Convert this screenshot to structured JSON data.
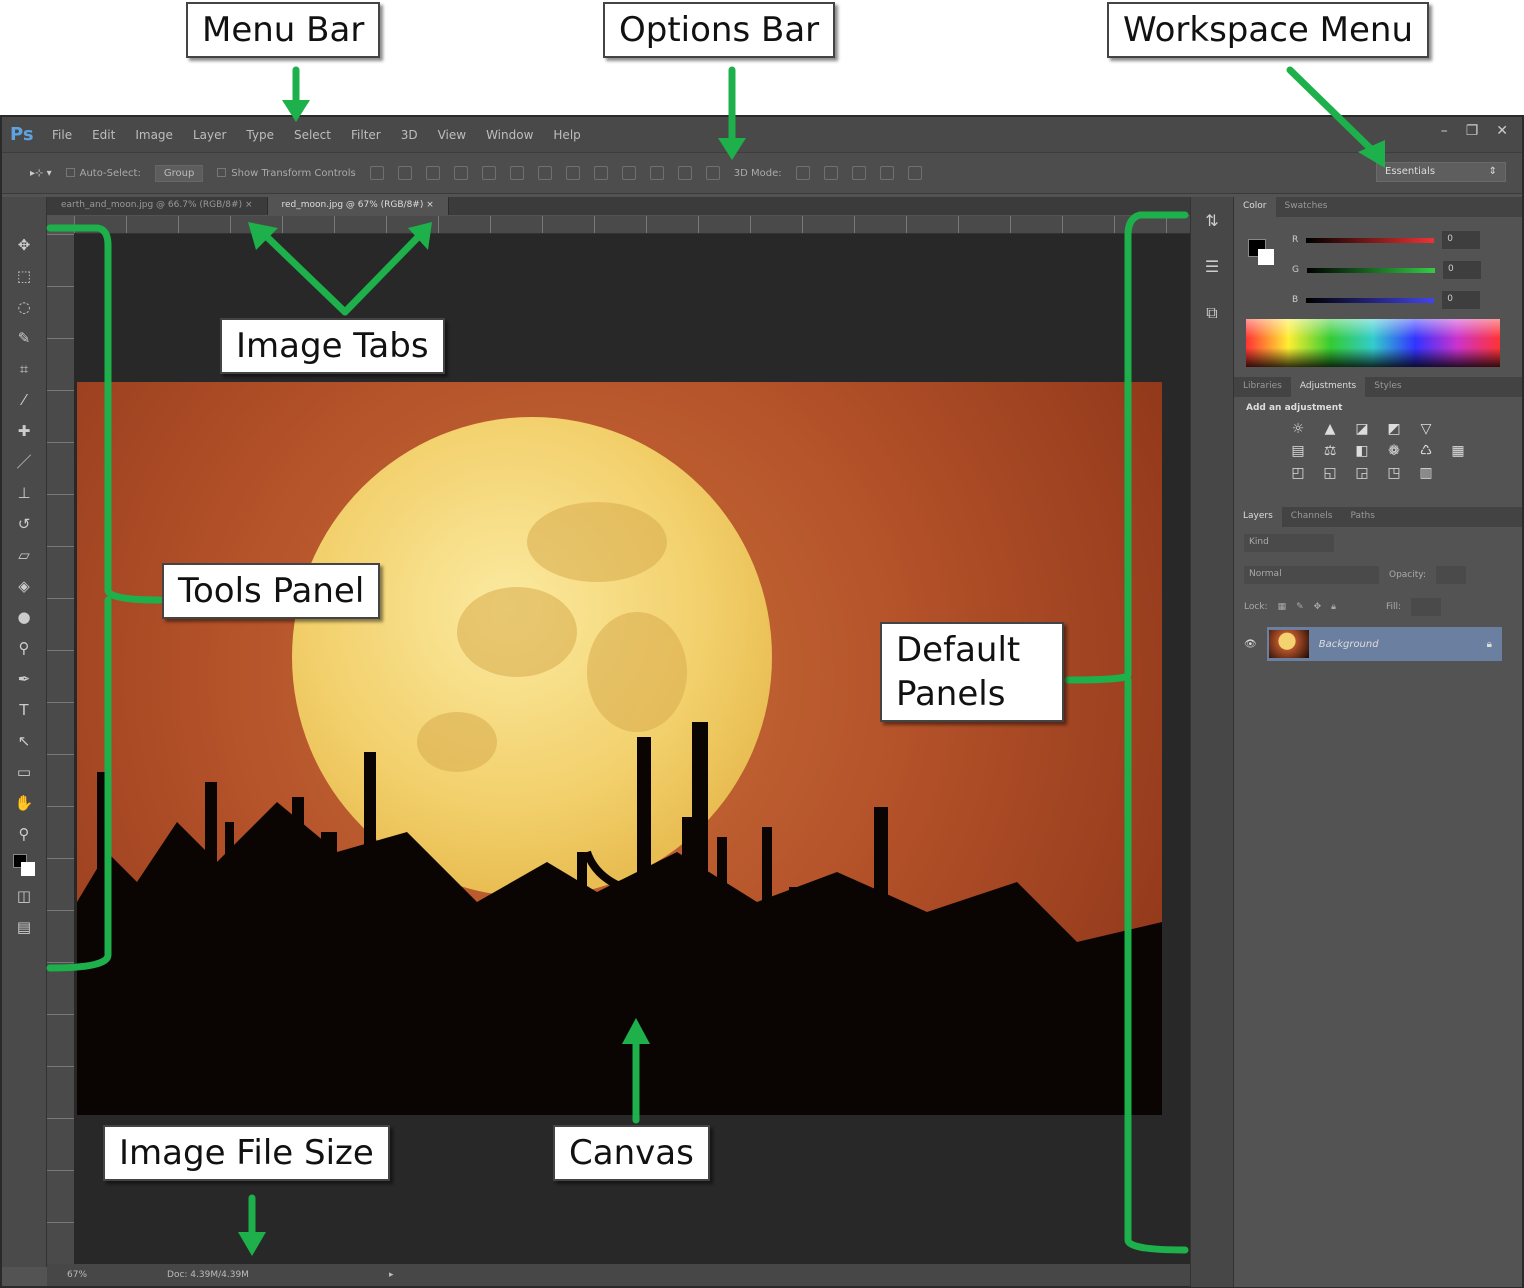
{
  "annotations": {
    "menu_bar": "Menu Bar",
    "options_bar": "Options Bar",
    "workspace_menu": "Workspace Menu",
    "image_tabs": "Image Tabs",
    "tools_panel": "Tools Panel",
    "default_panels": "Default Panels",
    "image_file_size": "Image File Size",
    "canvas": "Canvas"
  },
  "app": {
    "logo": "Ps"
  },
  "menu": [
    "File",
    "Edit",
    "Image",
    "Layer",
    "Type",
    "Select",
    "Filter",
    "3D",
    "View",
    "Window",
    "Help"
  ],
  "window_controls": {
    "minimize": "–",
    "restore": "❐",
    "close": "✕"
  },
  "options": {
    "auto_select": "Auto-Select:",
    "group": "Group",
    "show_transform": "Show Transform Controls",
    "mode_3d": "3D Mode:"
  },
  "workspace": {
    "value": "Essentials"
  },
  "tabs": [
    {
      "label": "earth_and_moon.jpg @ 66.7% (RGB/8#)"
    },
    {
      "label": "red_moon.jpg @ 67% (RGB/8#)"
    }
  ],
  "status": {
    "zoom": "67%",
    "doc": "Doc: 4.39M/4.39M"
  },
  "color_panel": {
    "tabs": [
      "Color",
      "Swatches"
    ],
    "r_label": "R",
    "g_label": "G",
    "b_label": "B",
    "r": "0",
    "g": "0",
    "b": "0"
  },
  "adjust_panel": {
    "tabs": [
      "Libraries",
      "Adjustments",
      "Styles"
    ],
    "heading": "Add an adjustment"
  },
  "layers_panel": {
    "tabs": [
      "Layers",
      "Channels",
      "Paths"
    ],
    "kind": "Kind",
    "blend": "Normal",
    "opacity_label": "Opacity:",
    "lock_label": "Lock:",
    "fill_label": "Fill:",
    "layer_name": "Background"
  },
  "colors": {
    "accent_green": "#1db04b",
    "ui_dark": "#535353",
    "selected_layer": "#6b7fa0"
  }
}
